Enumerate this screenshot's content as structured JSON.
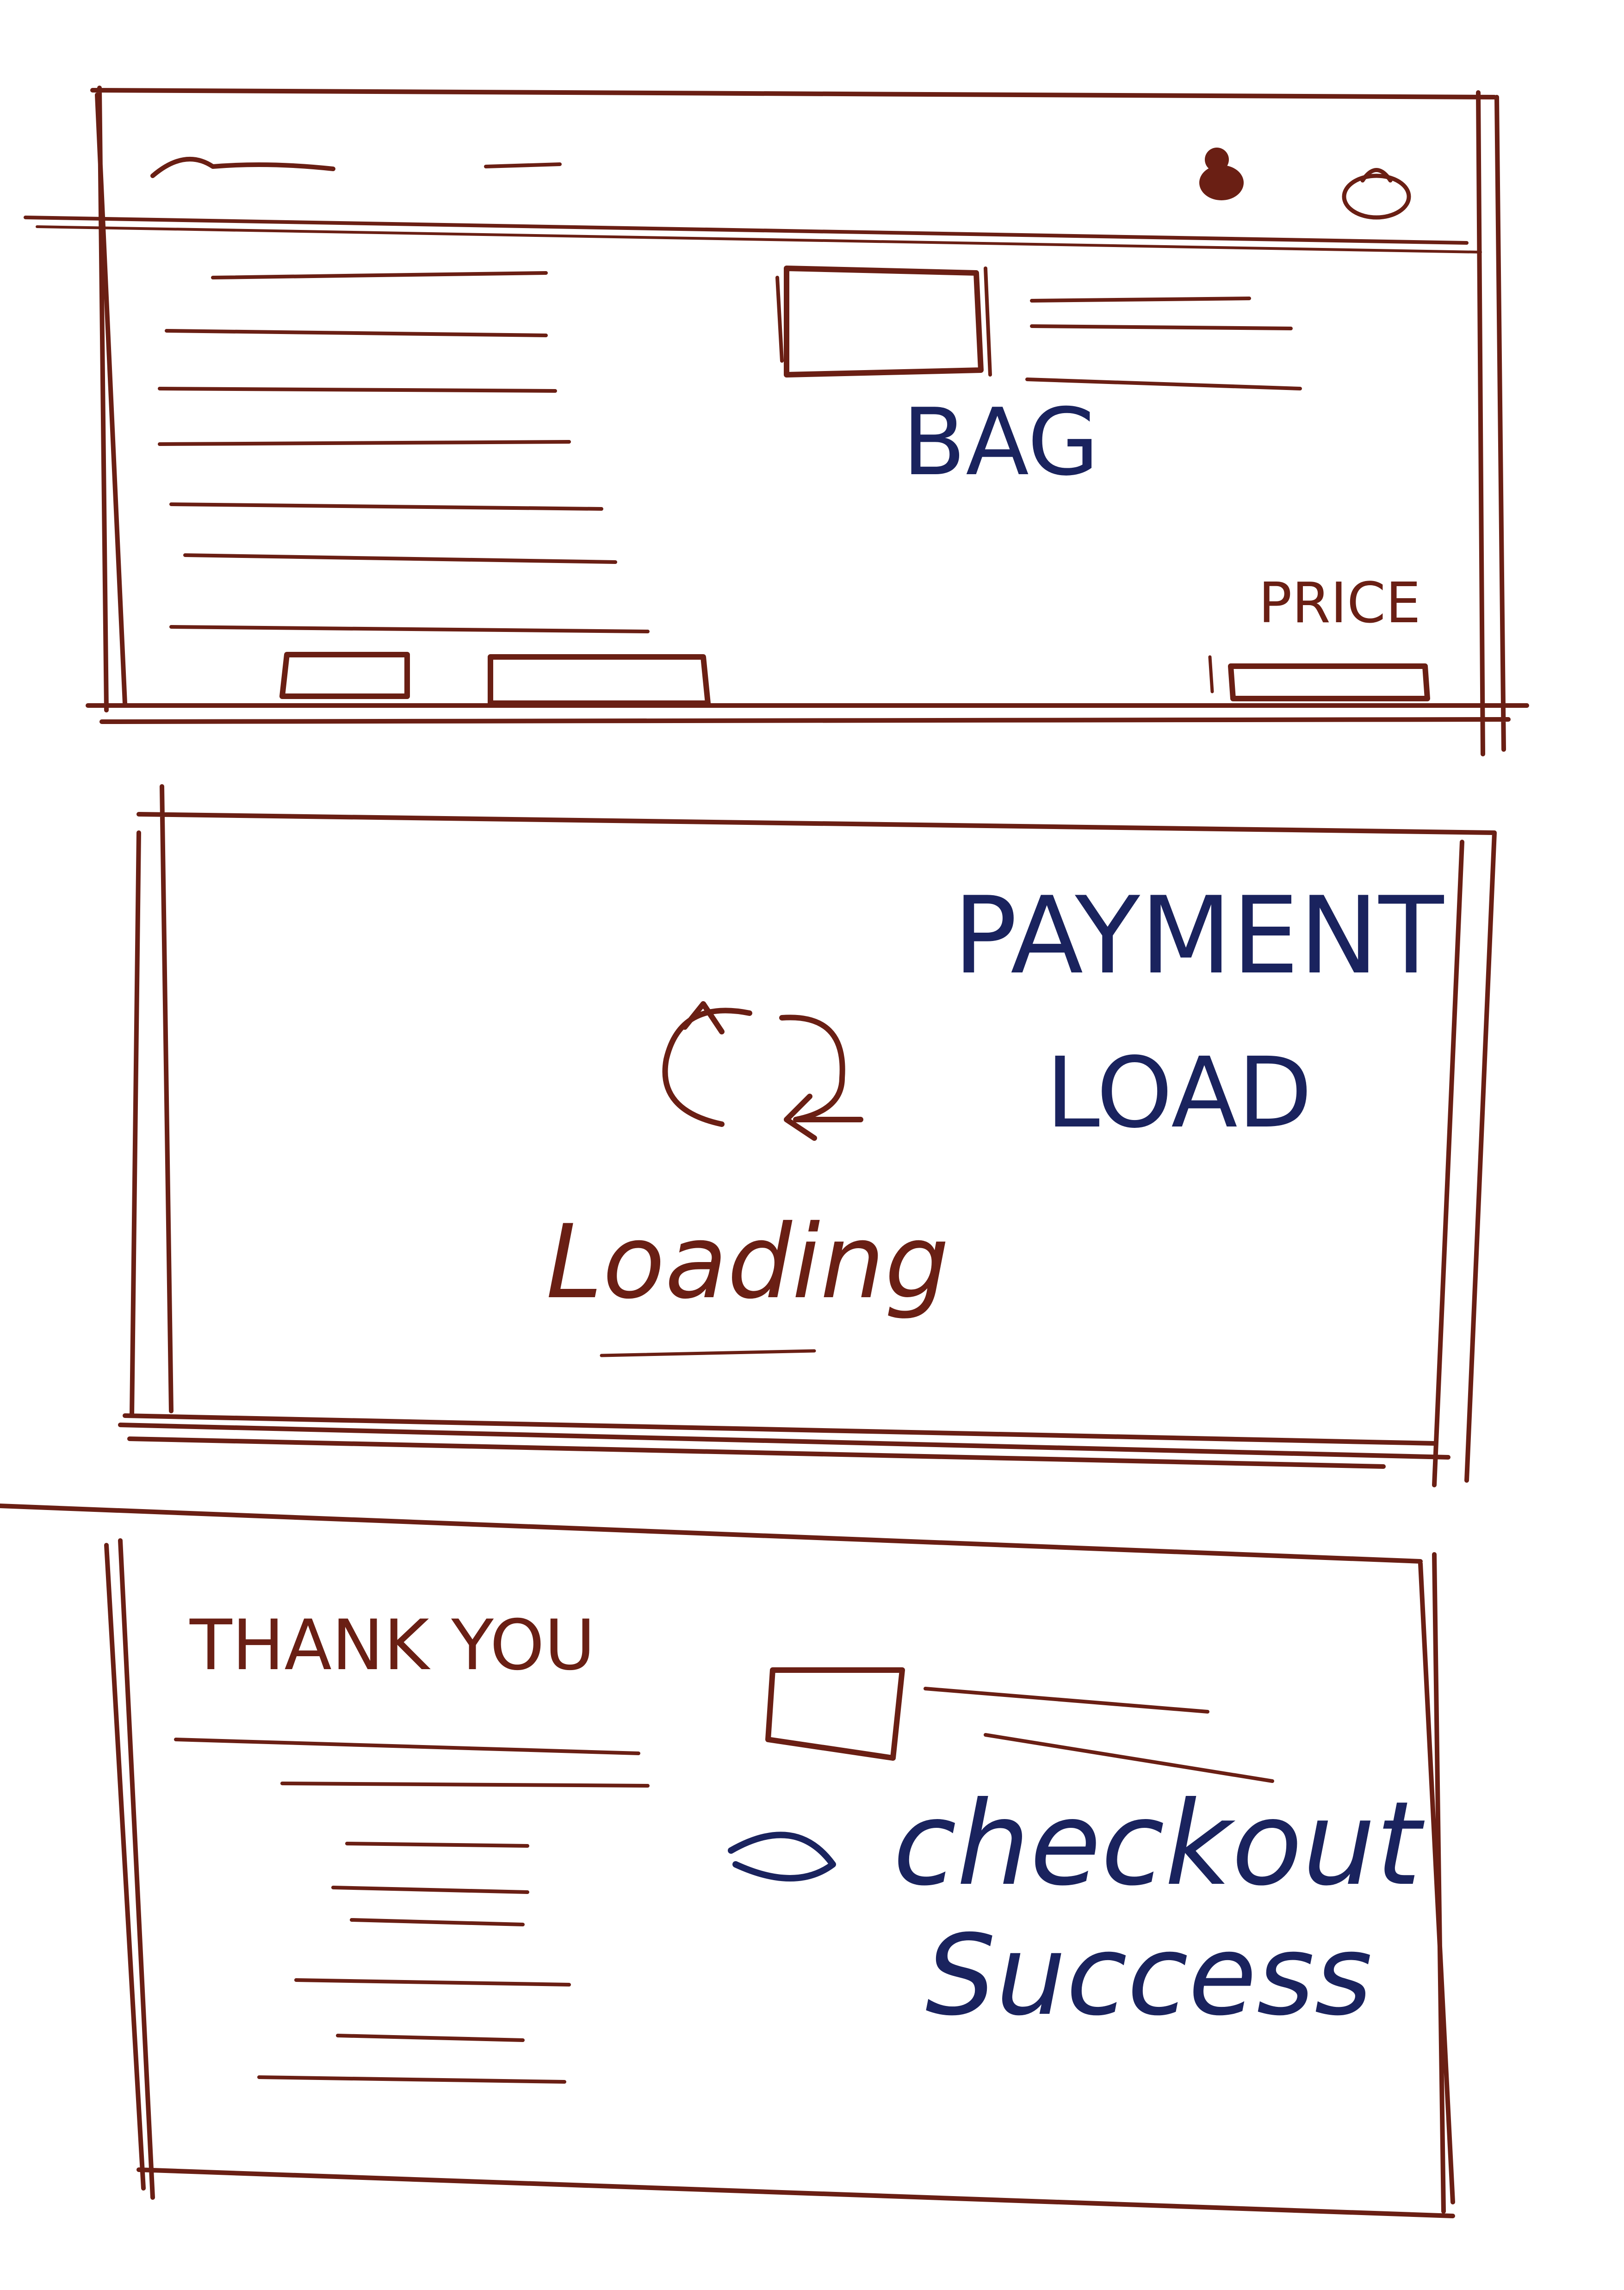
{
  "colors": {
    "sketch_ink": "#6a1f14",
    "annotation_ink": "#1a235e",
    "paper": "#ffffff"
  },
  "screens": {
    "bag": {
      "annotation": "BAG",
      "price_label": "PRICE",
      "header_icons": [
        "user-icon",
        "bag-icon"
      ]
    },
    "payment": {
      "annotation_line1": "PAYMENT",
      "annotation_line2": "LOAD",
      "status_text": "Loading",
      "spinner_icon": "refresh-icon"
    },
    "success": {
      "heading": "THANK YOU",
      "annotation_line1": "checkout",
      "annotation_line2": "Success"
    }
  }
}
